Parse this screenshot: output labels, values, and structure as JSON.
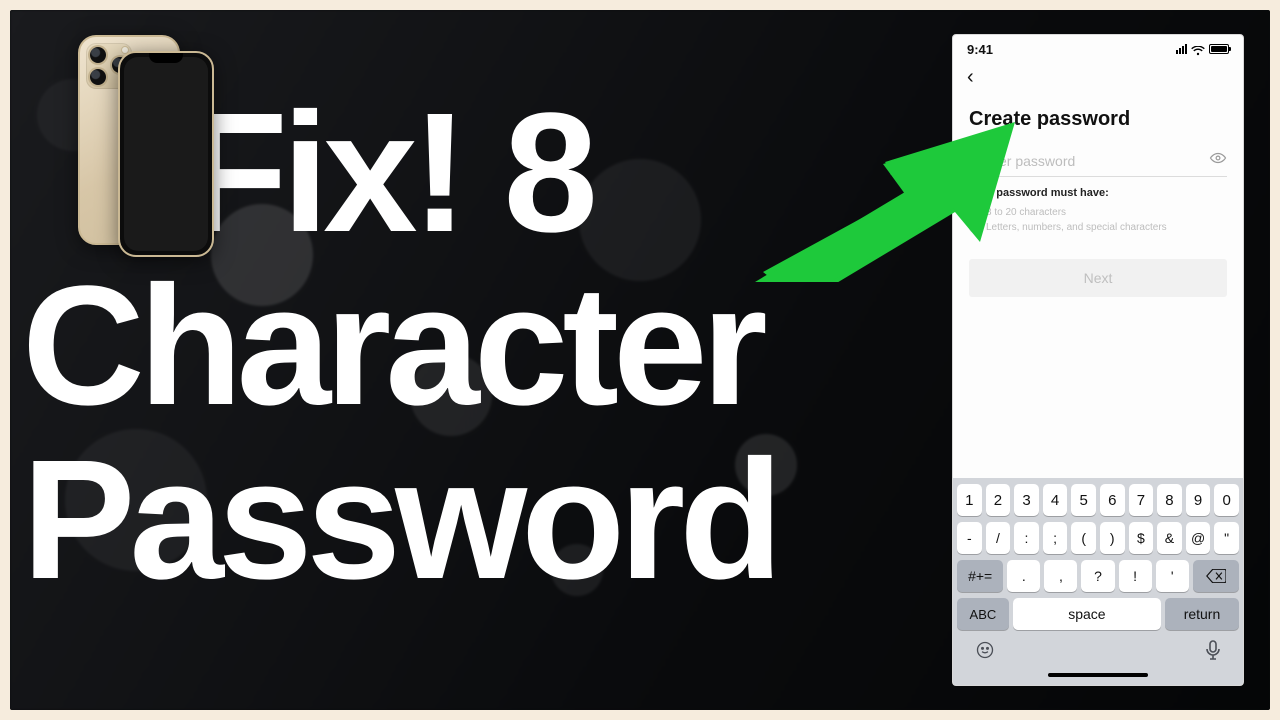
{
  "headline": {
    "line1": "Fix! 8",
    "line2": "Character",
    "line3": "Password"
  },
  "arrow": {
    "color": "#1ec93b"
  },
  "device_illustration": {
    "model_hint": "iPhone (gold), front+back",
    "apple_logo_glyph": ""
  },
  "phone": {
    "status": {
      "time": "9:41"
    },
    "back_glyph": "‹",
    "title": "Create password",
    "password_field": {
      "placeholder": "Enter password",
      "value": ""
    },
    "requirements": {
      "heading": "Your password must have:",
      "items": [
        "8 to 20 characters",
        "Letters, numbers, and special characters"
      ]
    },
    "next_label": "Next",
    "keyboard": {
      "row1": [
        "1",
        "2",
        "3",
        "4",
        "5",
        "6",
        "7",
        "8",
        "9",
        "0"
      ],
      "row2": [
        "-",
        "/",
        ":",
        ";",
        "(",
        ")",
        "$",
        "&",
        "@",
        "\""
      ],
      "shift_label": "#+=",
      "row3": [
        ".",
        ",",
        "?",
        "!",
        "'"
      ],
      "abc_label": "ABC",
      "space_label": "space",
      "return_label": "return"
    }
  }
}
